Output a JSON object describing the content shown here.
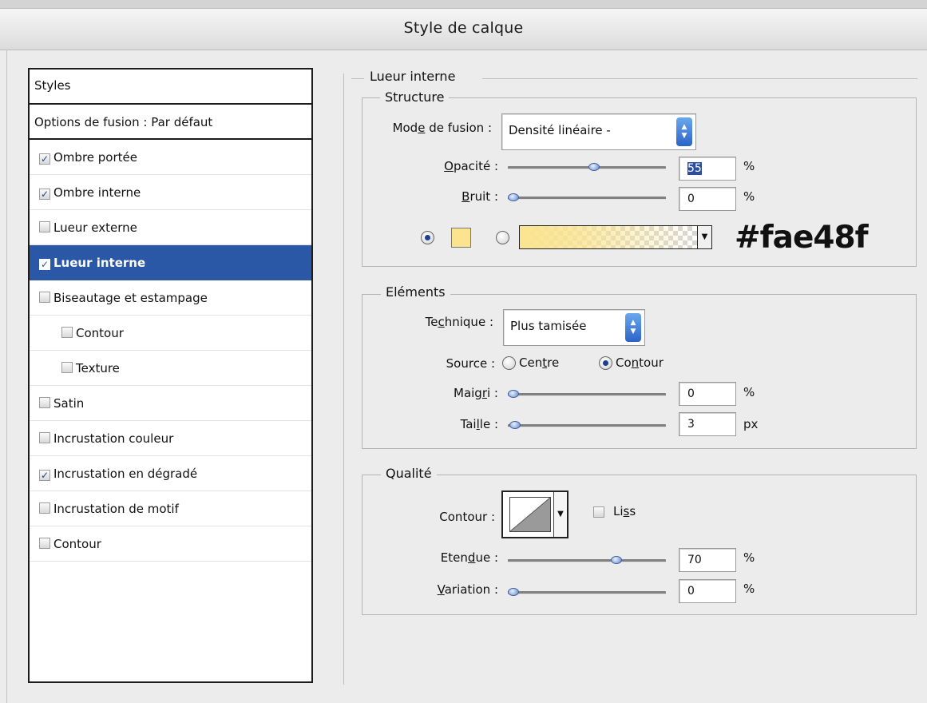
{
  "window": {
    "title": "Style de calque"
  },
  "sidebar": {
    "header": "Styles",
    "blend_options": "Options de fusion : Par défaut",
    "items": [
      {
        "label": "Ombre portée",
        "checked": true,
        "selected": false,
        "indent": false
      },
      {
        "label": "Ombre interne",
        "checked": true,
        "selected": false,
        "indent": false
      },
      {
        "label": "Lueur externe",
        "checked": false,
        "selected": false,
        "indent": false
      },
      {
        "label": "Lueur interne",
        "checked": true,
        "selected": true,
        "indent": false
      },
      {
        "label": "Biseautage et estampage",
        "checked": false,
        "selected": false,
        "indent": false
      },
      {
        "label": "Contour",
        "checked": false,
        "selected": false,
        "indent": true
      },
      {
        "label": "Texture",
        "checked": false,
        "selected": false,
        "indent": true
      },
      {
        "label": "Satin",
        "checked": false,
        "selected": false,
        "indent": false
      },
      {
        "label": "Incrustation couleur",
        "checked": false,
        "selected": false,
        "indent": false
      },
      {
        "label": "Incrustation en dégradé",
        "checked": true,
        "selected": false,
        "indent": false
      },
      {
        "label": "Incrustation de motif",
        "checked": false,
        "selected": false,
        "indent": false
      },
      {
        "label": "Contour",
        "checked": false,
        "selected": false,
        "indent": false
      }
    ]
  },
  "panel": {
    "section_title": "Lueur interne",
    "structure": {
      "title": "Structure",
      "blend_mode": {
        "label": "Mode de fusion :",
        "value": "Densité linéaire -"
      },
      "opacity": {
        "label": "Opacité :",
        "value": "55",
        "unit": "%",
        "level": 0.55
      },
      "noise": {
        "label": "Bruit :",
        "value": "0",
        "unit": "%",
        "level": 0
      },
      "color": {
        "swatch": "#fae48f",
        "color_mode_selected": "solid",
        "gradient_mode_selected": false
      },
      "hex_annotation": "#fae48f"
    },
    "elements": {
      "title": "Eléments",
      "technique": {
        "label": "Technique :",
        "value": "Plus tamisée"
      },
      "source": {
        "label": "Source :",
        "options": [
          "Centre",
          "Contour"
        ],
        "selected": "Contour"
      },
      "choke": {
        "label": "Maigri :",
        "value": "0",
        "unit": "%",
        "level": 0
      },
      "size": {
        "label": "Taille :",
        "value": "3",
        "unit": "px",
        "level": 0.01
      }
    },
    "quality": {
      "title": "Qualité",
      "contour": {
        "label": "Contour :"
      },
      "antialias": {
        "label": "Liss",
        "checked": false
      },
      "range": {
        "label": "Etendue :",
        "value": "70",
        "unit": "%",
        "level": 0.7
      },
      "jitter": {
        "label": "Variation :",
        "value": "0",
        "unit": "%",
        "level": 0
      }
    }
  },
  "colors": {
    "selection": "#2b57a7",
    "glow": "#fae48f"
  }
}
